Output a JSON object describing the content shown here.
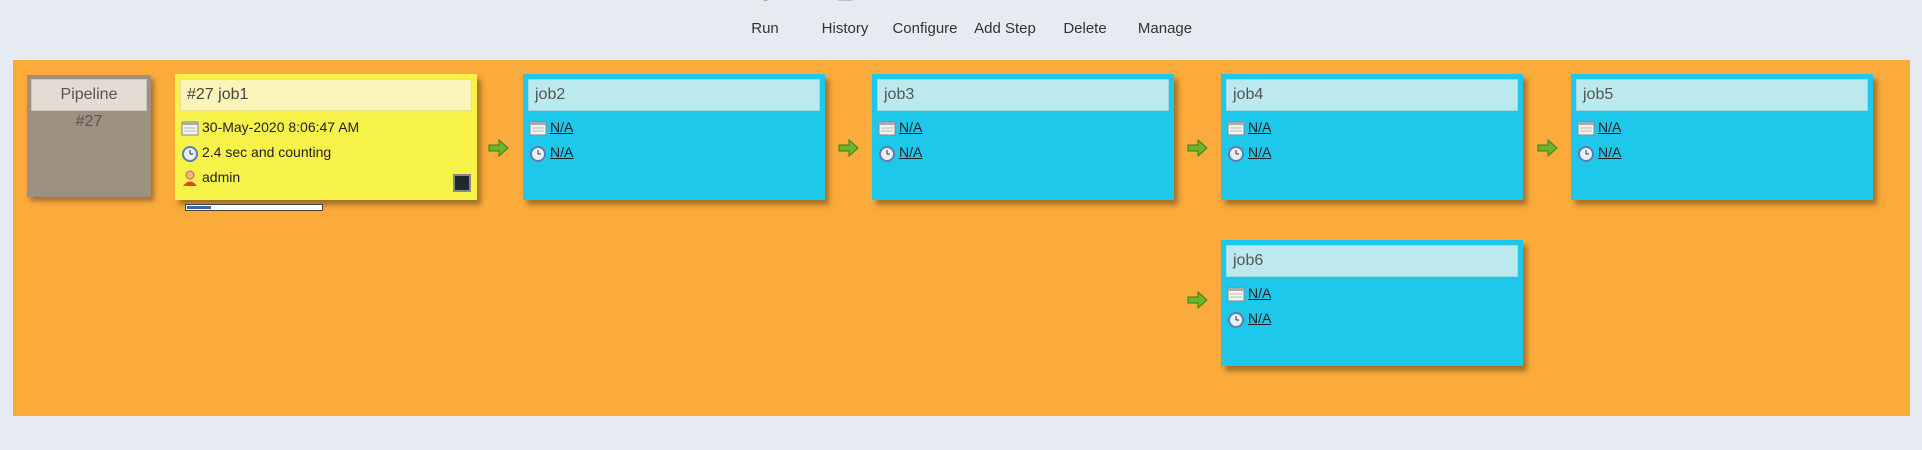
{
  "toolbar": {
    "run_label": "Run",
    "history_label": "History",
    "configure_label": "Configure",
    "add_step_label": "Add Step",
    "delete_label": "Delete",
    "manage_label": "Manage"
  },
  "pipeline": {
    "title": "Pipeline",
    "build_number": "#27"
  },
  "jobs": [
    {
      "name": "#27 job1",
      "date": "30-May-2020 8:06:47 AM",
      "duration": "2.4 sec and counting",
      "user": "admin",
      "progress": 0.18,
      "status": "running"
    },
    {
      "name": "job2",
      "date": "N/A",
      "duration": "N/A",
      "status": "not-built"
    },
    {
      "name": "job3",
      "date": "N/A",
      "duration": "N/A",
      "status": "not-built"
    },
    {
      "name": "job4",
      "date": "N/A",
      "duration": "N/A",
      "status": "not-built"
    },
    {
      "name": "job5",
      "date": "N/A",
      "duration": "N/A",
      "status": "not-built"
    },
    {
      "name": "job6",
      "date": "N/A",
      "duration": "N/A",
      "status": "not-built"
    }
  ],
  "colors": {
    "canvas": "#fbab3c",
    "running_job": "#f7f24a",
    "pending_job": "#1ec8eb",
    "pipeline_card": "#9d9081",
    "arrow": "#6ab62c"
  },
  "icons": {
    "calendar": "calendar-icon",
    "clock": "clock-icon",
    "user": "user-icon",
    "console": "console-icon",
    "arrow": "arrow-right-icon"
  }
}
